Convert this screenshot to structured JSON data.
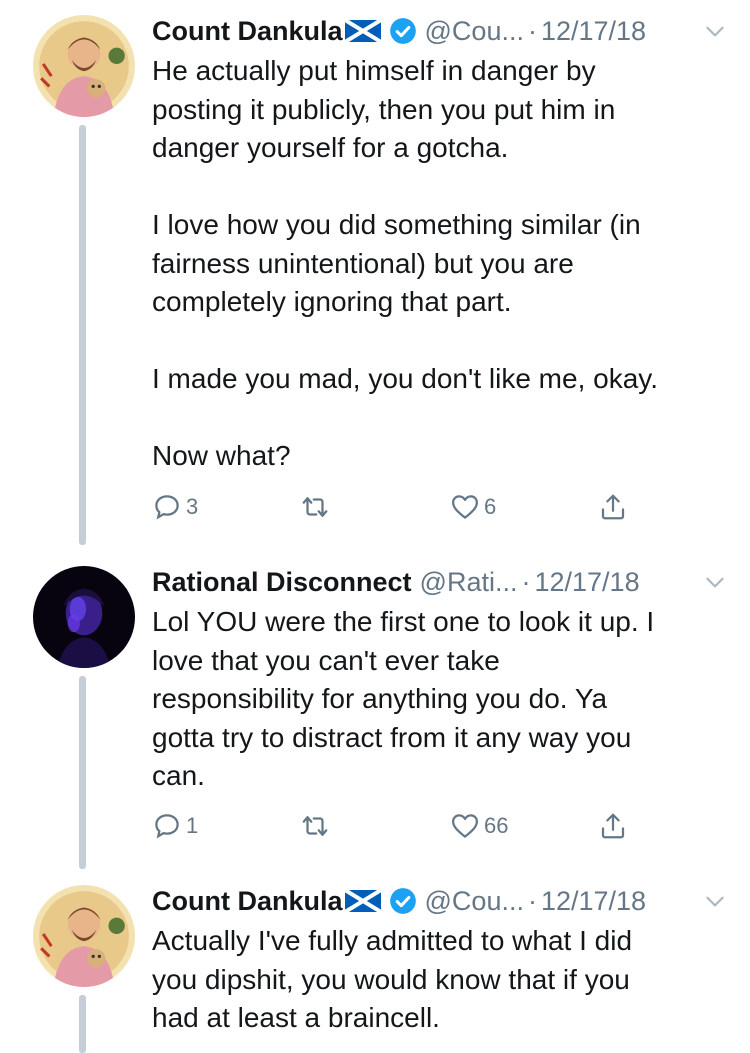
{
  "tweets": [
    {
      "name": "Count Dankula",
      "flag_icon": "scotland-flag-icon",
      "verified_icon": "verified-badge-icon",
      "handle": "@Cou...",
      "dot": "·",
      "date": "12/17/18",
      "body": "He actually put himself in danger by\nposting it publicly, then you put him in\ndanger yourself for a gotcha.\n\nI love how you did something similar (in\nfairness unintentional) but you are\ncompletely ignoring that part.\n\nI made you mad, you don't like me, okay.\n\nNow what?",
      "replies": "3",
      "retweets": "",
      "likes": "6"
    },
    {
      "name": "Rational Disconnect",
      "handle": "@Rati...",
      "dot": "·",
      "date": "12/17/18",
      "body": "Lol YOU were the first one to look it up. I\nlove that you can't ever take\nresponsibility for anything you do. Ya\ngotta try to distract from it any way you\ncan.",
      "replies": "1",
      "retweets": "",
      "likes": "66"
    },
    {
      "name": "Count Dankula",
      "flag_icon": "scotland-flag-icon",
      "verified_icon": "verified-badge-icon",
      "handle": "@Cou...",
      "dot": "·",
      "date": "12/17/18",
      "body": "Actually I've fully admitted to what I did\nyou dipshit, you would know that if you\nhad at least a braincell."
    }
  ],
  "colors": {
    "text": "#14171a",
    "secondary": "#657786",
    "verified": "#1da1f2",
    "thread_line": "#c5cdd6",
    "flag_blue": "#005eb8"
  }
}
